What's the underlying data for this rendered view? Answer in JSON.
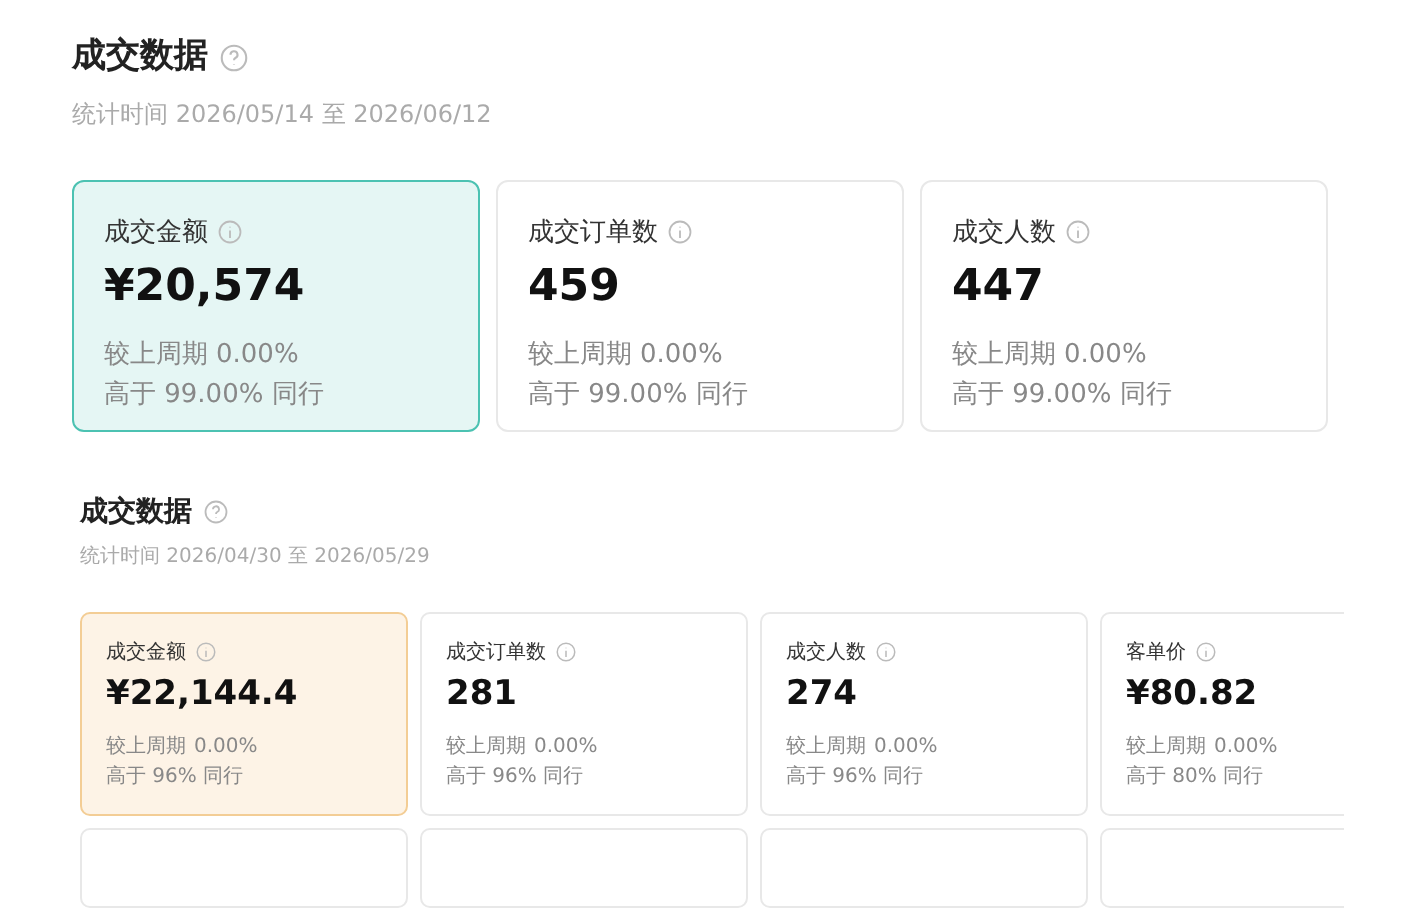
{
  "sections": [
    {
      "kind": "large",
      "title": "成交数据",
      "period": "统计时间 2026/05/14 至 2026/06/12",
      "cards": [
        {
          "label": "成交金额",
          "value": "¥20,574",
          "compare_label": "较上周期",
          "compare_value": "0.00%",
          "rank": "高于 99.00% 同行",
          "selected": true
        },
        {
          "label": "成交订单数",
          "value": "459",
          "compare_label": "较上周期",
          "compare_value": "0.00%",
          "rank": "高于 99.00% 同行",
          "selected": false
        },
        {
          "label": "成交人数",
          "value": "447",
          "compare_label": "较上周期",
          "compare_value": "0.00%",
          "rank": "高于 99.00% 同行",
          "selected": false
        }
      ]
    },
    {
      "kind": "compact",
      "title": "成交数据",
      "period": "统计时间 2026/04/30 至 2026/05/29",
      "cards": [
        {
          "label": "成交金额",
          "value": "¥22,144.4",
          "compare_label": "较上周期",
          "compare_value": "0.00%",
          "rank": "高于 96% 同行",
          "selected": true
        },
        {
          "label": "成交订单数",
          "value": "281",
          "compare_label": "较上周期",
          "compare_value": "0.00%",
          "rank": "高于 96% 同行",
          "selected": false
        },
        {
          "label": "成交人数",
          "value": "274",
          "compare_label": "较上周期",
          "compare_value": "0.00%",
          "rank": "高于 96% 同行",
          "selected": false
        },
        {
          "label": "客单价",
          "value": "¥80.82",
          "compare_label": "较上周期",
          "compare_value": "0.00%",
          "rank": "高于 80% 同行",
          "selected": false
        }
      ]
    }
  ]
}
